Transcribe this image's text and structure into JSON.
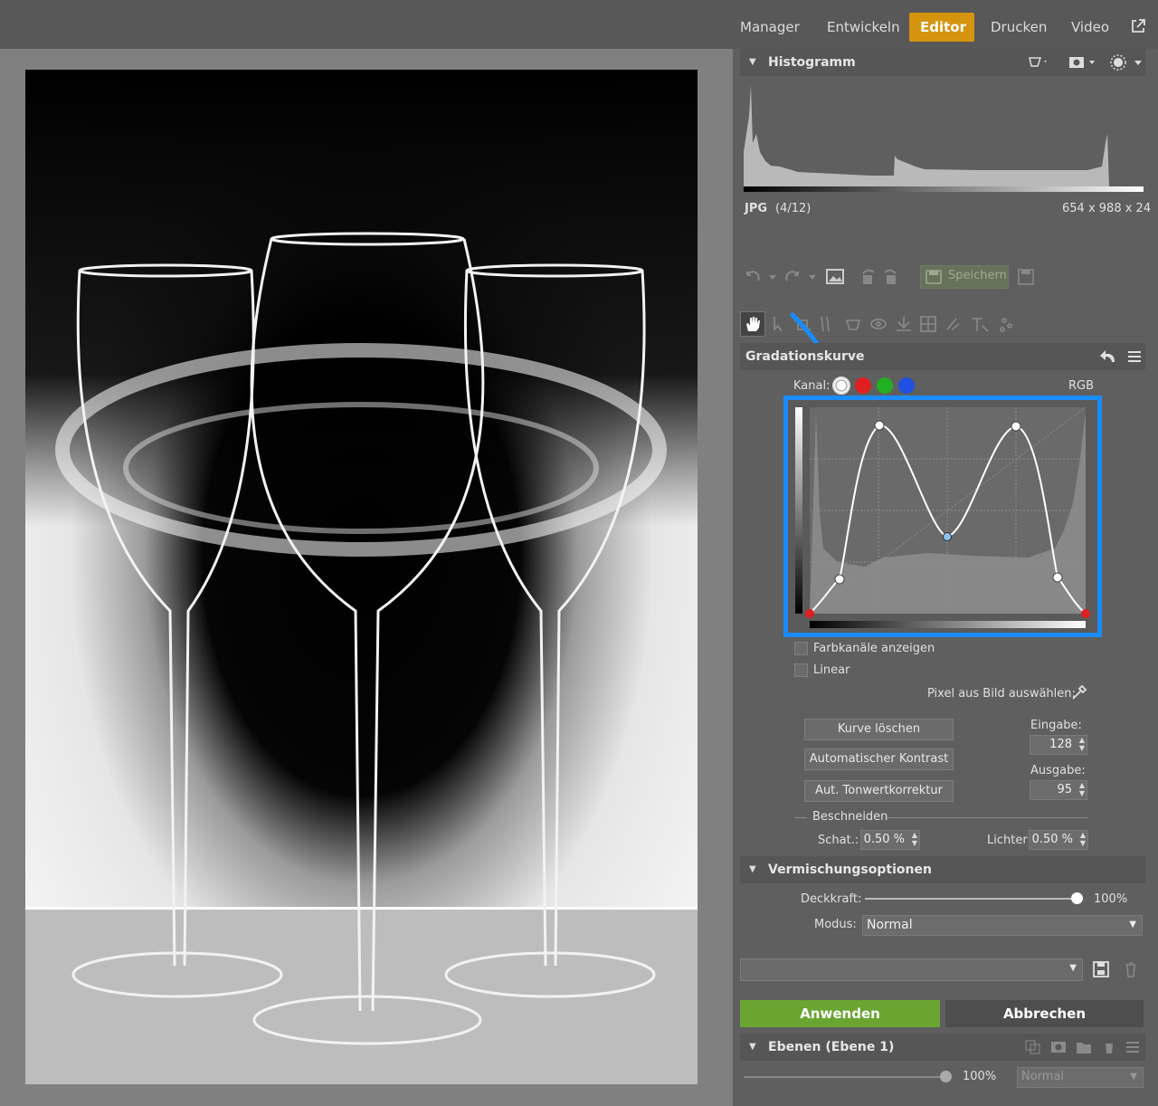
{
  "nav": {
    "tabs": [
      "Manager",
      "Entwickeln",
      "Editor",
      "Drucken",
      "Video"
    ],
    "active": "Editor"
  },
  "histogram": {
    "title": "Histogramm",
    "format": "JPG",
    "index": "(4/12)",
    "dimensions": "654 x 988 x 24"
  },
  "toolbar": {
    "save_label": "Speichern"
  },
  "curve": {
    "title": "Gradationskurve",
    "kanal_label": "Kanal:",
    "channel": "RGB",
    "show_channels": "Farbkanäle anzeigen",
    "linear": "Linear",
    "pick_pixel": "Pixel aus Bild auswählen:",
    "btn_clear": "Kurve löschen",
    "btn_auto_contrast": "Automatischer Kontrast",
    "btn_auto_levels": "Aut. Tonwertkorrektur",
    "input_label": "Eingabe:",
    "input_value": "128",
    "output_label": "Ausgabe:",
    "output_value": "95",
    "clip_label": "Beschneiden",
    "shadows_label": "Schat.:",
    "shadows_value": "0.50 %",
    "highlights_label": "Lichter:",
    "highlights_value": "0.50 %",
    "channel_colors": [
      "#ffffff",
      "#e02020",
      "#22b022",
      "#2050e0"
    ],
    "highlight_color": "#1a8cff"
  },
  "blend": {
    "title": "Vermischungsoptionen",
    "opacity_label": "Deckkraft:",
    "opacity_value": "100%",
    "opacity": 1.0,
    "mode_label": "Modus:",
    "mode_value": "Normal"
  },
  "actions": {
    "apply": "Anwenden",
    "cancel": "Abbrechen"
  },
  "layers": {
    "title": "Ebenen (Ebene 1)",
    "opacity_value": "100%",
    "mode_value": "Normal"
  }
}
